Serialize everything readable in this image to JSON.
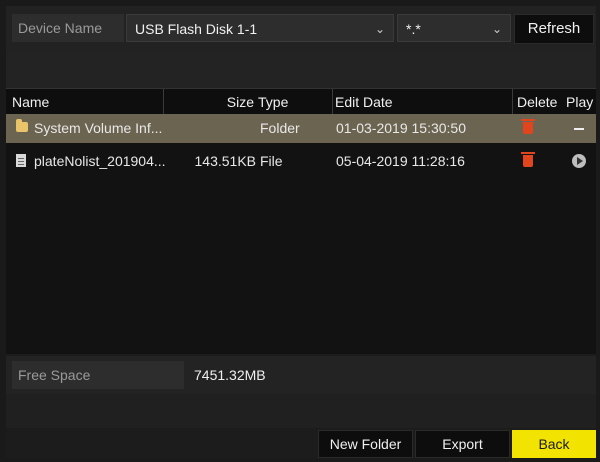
{
  "device_name_label": "Device Name",
  "device_select": {
    "value": "USB Flash Disk 1-1"
  },
  "filter_select": {
    "value": "*.*"
  },
  "refresh_label": "Refresh",
  "columns": {
    "name": "Name",
    "size": "Size",
    "type": "Type",
    "edit_date": "Edit Date",
    "delete": "Delete",
    "play": "Play"
  },
  "files": [
    {
      "name": "System Volume Inf...",
      "size": "",
      "type": "Folder",
      "edit_date": "01-03-2019 15:30:50",
      "icon": "folder-icon",
      "play_icon": "dash-icon",
      "selected": true
    },
    {
      "name": "plateNolist_201904...",
      "size": "143.51KB",
      "type": "File",
      "edit_date": "05-04-2019 11:28:16",
      "icon": "file-icon",
      "play_icon": "play-icon",
      "selected": false
    }
  ],
  "free_space": {
    "label": "Free Space",
    "value": "7451.32MB"
  },
  "buttons": {
    "new_folder": "New Folder",
    "export": "Export",
    "back": "Back"
  },
  "colors": {
    "selected_row": "#6b6450",
    "back_button": "#f3e300",
    "delete_icon": "#e0451e",
    "folder_icon": "#e9c46a"
  }
}
